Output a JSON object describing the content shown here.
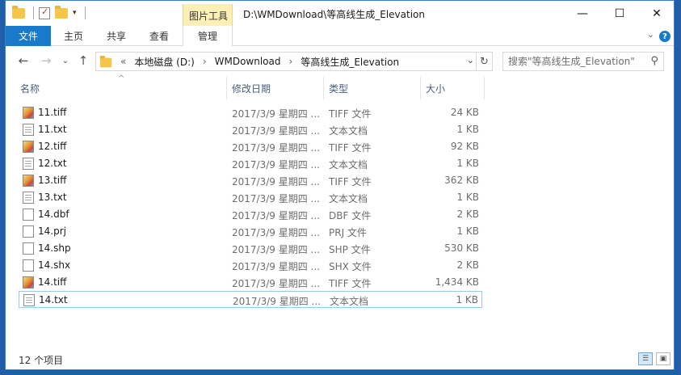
{
  "titlebar": {
    "tools_tab": "图片工具",
    "path_title": "D:\\WMDownload\\等高线生成_Elevation",
    "minimize": "—",
    "maximize": "☐",
    "close": "✕"
  },
  "ribbon": {
    "tabs": [
      "文件",
      "主页",
      "共享",
      "查看",
      "管理"
    ],
    "help": "?",
    "collapse": "⌄"
  },
  "nav": {
    "back": "←",
    "forward": "→",
    "recent": "⌄",
    "up": "↑",
    "crumbs": [
      "«",
      "本地磁盘 (D:)",
      "WMDownload",
      "等高线生成_Elevation"
    ],
    "crumb_sep": "›",
    "refresh": "↻",
    "search_placeholder": "搜索\"等高线生成_Elevation\"",
    "search_icon": "⚲"
  },
  "columns": {
    "name": "名称",
    "date": "修改日期",
    "type": "类型",
    "size": "大小",
    "sort_indicator": "^"
  },
  "files": [
    {
      "name": "11.tiff",
      "date": "2017/3/9 星期四 ...",
      "type": "TIFF 文件",
      "size": "24 KB",
      "icon": "image-icon"
    },
    {
      "name": "11.txt",
      "date": "2017/3/9 星期四 ...",
      "type": "文本文档",
      "size": "1 KB",
      "icon": "text-file-icon"
    },
    {
      "name": "12.tiff",
      "date": "2017/3/9 星期四 ...",
      "type": "TIFF 文件",
      "size": "92 KB",
      "icon": "image-icon"
    },
    {
      "name": "12.txt",
      "date": "2017/3/9 星期四 ...",
      "type": "文本文档",
      "size": "1 KB",
      "icon": "text-file-icon"
    },
    {
      "name": "13.tiff",
      "date": "2017/3/9 星期四 ...",
      "type": "TIFF 文件",
      "size": "362 KB",
      "icon": "image-icon"
    },
    {
      "name": "13.txt",
      "date": "2017/3/9 星期四 ...",
      "type": "文本文档",
      "size": "1 KB",
      "icon": "text-file-icon"
    },
    {
      "name": "14.dbf",
      "date": "2017/3/9 星期四 ...",
      "type": "DBF 文件",
      "size": "2 KB",
      "icon": "file-icon"
    },
    {
      "name": "14.prj",
      "date": "2017/3/9 星期四 ...",
      "type": "PRJ 文件",
      "size": "1 KB",
      "icon": "file-icon"
    },
    {
      "name": "14.shp",
      "date": "2017/3/9 星期四 ...",
      "type": "SHP 文件",
      "size": "530 KB",
      "icon": "file-icon"
    },
    {
      "name": "14.shx",
      "date": "2017/3/9 星期四 ...",
      "type": "SHX 文件",
      "size": "2 KB",
      "icon": "file-icon"
    },
    {
      "name": "14.tiff",
      "date": "2017/3/9 星期四 ...",
      "type": "TIFF 文件",
      "size": "1,434 KB",
      "icon": "image-icon"
    },
    {
      "name": "14.txt",
      "date": "2017/3/9 星期四 ...",
      "type": "文本文档",
      "size": "1 KB",
      "icon": "text-file-icon"
    }
  ],
  "status": {
    "count": "12 个项目",
    "details_view_icon": "☰",
    "thumbnail_view_icon": "▣"
  },
  "colors": {
    "accent": "#1979ca",
    "tools_tab": "#fcf0b6",
    "selection_border": "#99c9ef",
    "desktop": "#1f5fa8"
  }
}
